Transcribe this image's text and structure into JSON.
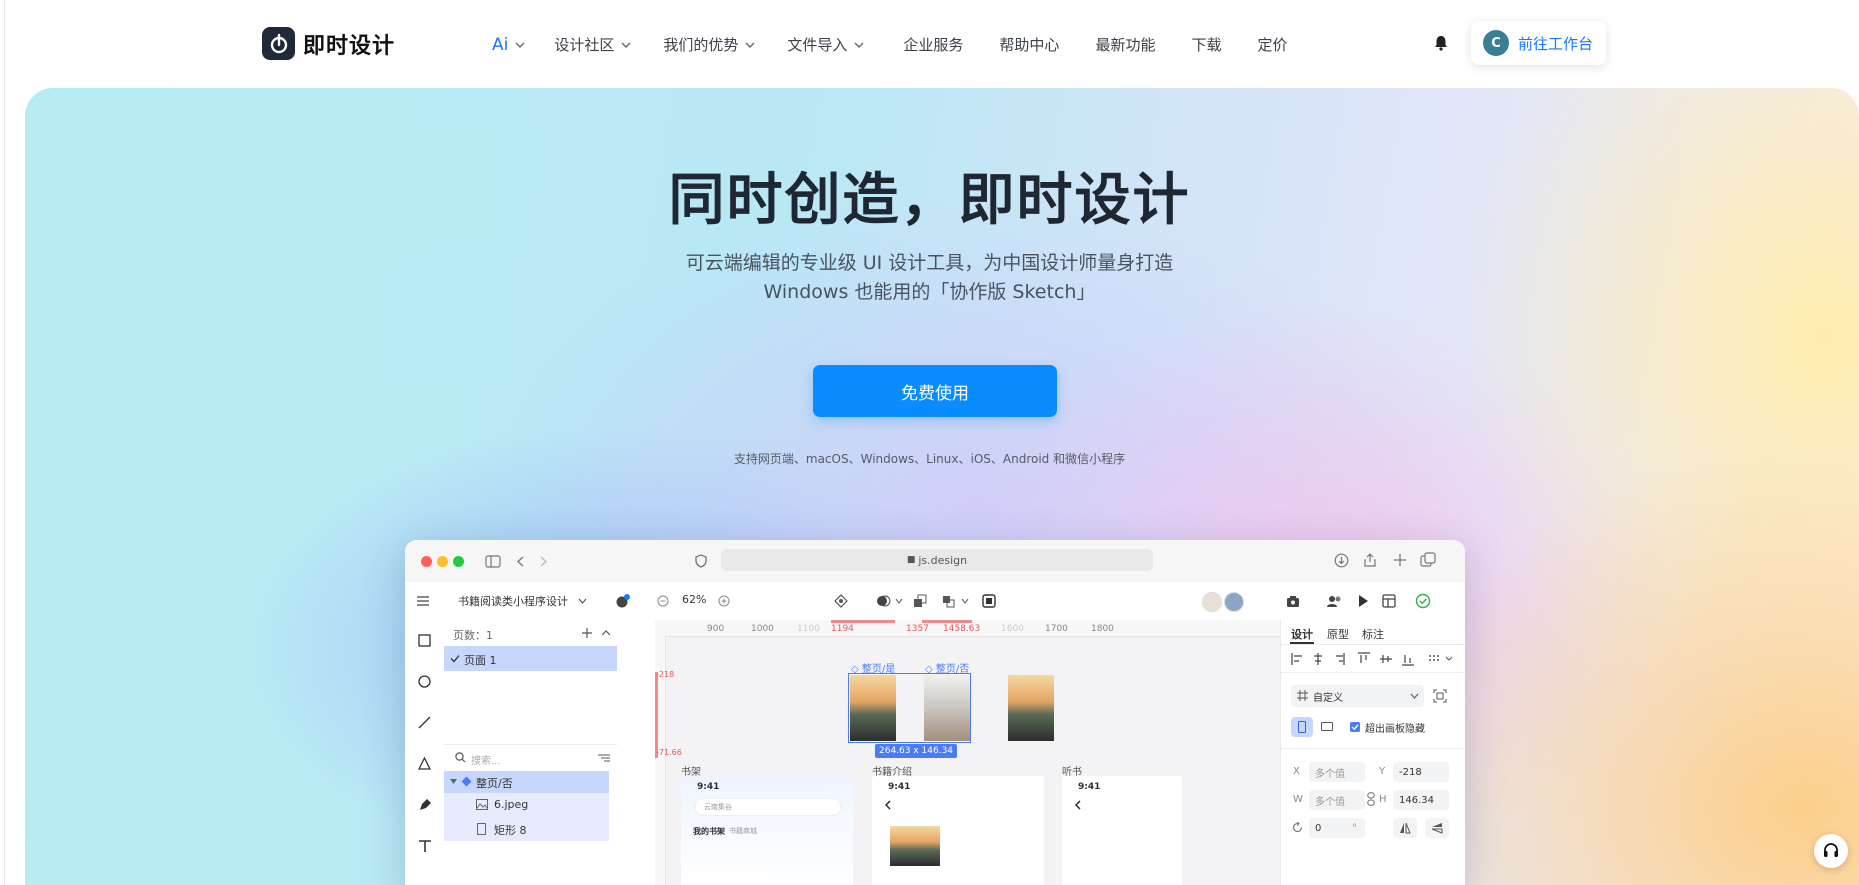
{
  "brand": {
    "name": "即时设计"
  },
  "nav": {
    "items": [
      {
        "label": "Ai",
        "has_dropdown": true
      },
      {
        "label": "设计社区",
        "has_dropdown": true
      },
      {
        "label": "我们的优势",
        "has_dropdown": true
      },
      {
        "label": "文件导入",
        "has_dropdown": true
      },
      {
        "label": "企业服务",
        "has_dropdown": false
      },
      {
        "label": "帮助中心",
        "has_dropdown": false
      },
      {
        "label": "最新功能",
        "has_dropdown": false
      },
      {
        "label": "下载",
        "has_dropdown": false
      },
      {
        "label": "定价",
        "has_dropdown": false
      }
    ],
    "workspace": {
      "avatar": "C",
      "label": "前往工作台"
    }
  },
  "hero": {
    "title": "同时创造，即时设计",
    "subtitle_line1": "可云端编辑的专业级 UI 设计工具，为中国设计师量身打造",
    "subtitle_line2": "Windows 也能用的「协作版 Sketch」",
    "cta": "免费使用",
    "support": "支持网页端、macOS、Windows、Linux、iOS、Android 和微信小程序"
  },
  "app": {
    "url": "js.design",
    "file_name": "书籍阅读类小程序设计",
    "zoom": "62%",
    "pages_header": "页数：1",
    "page_item": "页面 1",
    "search_placeholder": "搜索...",
    "layers": [
      {
        "label": "整页/否",
        "selected": true
      },
      {
        "label": "6.jpeg",
        "selected": false
      },
      {
        "label": "矩形 8",
        "selected": false
      }
    ],
    "ruler": {
      "ticks": [
        "900",
        "1000",
        "1100",
        "1194",
        "1357",
        "1458.63",
        "1600",
        "1700",
        "1800"
      ],
      "v_labels": [
        "-218",
        "-71.66"
      ]
    },
    "frames": {
      "label_a": "整页/是",
      "label_b": "整页/否",
      "size_badge": "264.63 x 146.34",
      "section_labels": [
        "书架",
        "书籍介绍",
        "听书"
      ],
      "phone_time": "9:41",
      "search_text": "云南集谷",
      "shelf_tab_1": "我的书架",
      "shelf_tab_2": "书籍商城"
    },
    "props": {
      "tabs": [
        "设计",
        "原型",
        "标注"
      ],
      "frame_type": "自定义",
      "clip_label": "超出画板隐藏",
      "x_label": "X",
      "x_value": "多个值",
      "y_label": "Y",
      "y_value": "-218",
      "w_label": "W",
      "w_value": "多个值",
      "h_label": "H",
      "h_value": "146.34",
      "rotation": "0",
      "rotation_unit": "°"
    }
  },
  "colors": {
    "accent": "#1677ff",
    "cta": "#0a8cff",
    "title": "#1f2733"
  }
}
